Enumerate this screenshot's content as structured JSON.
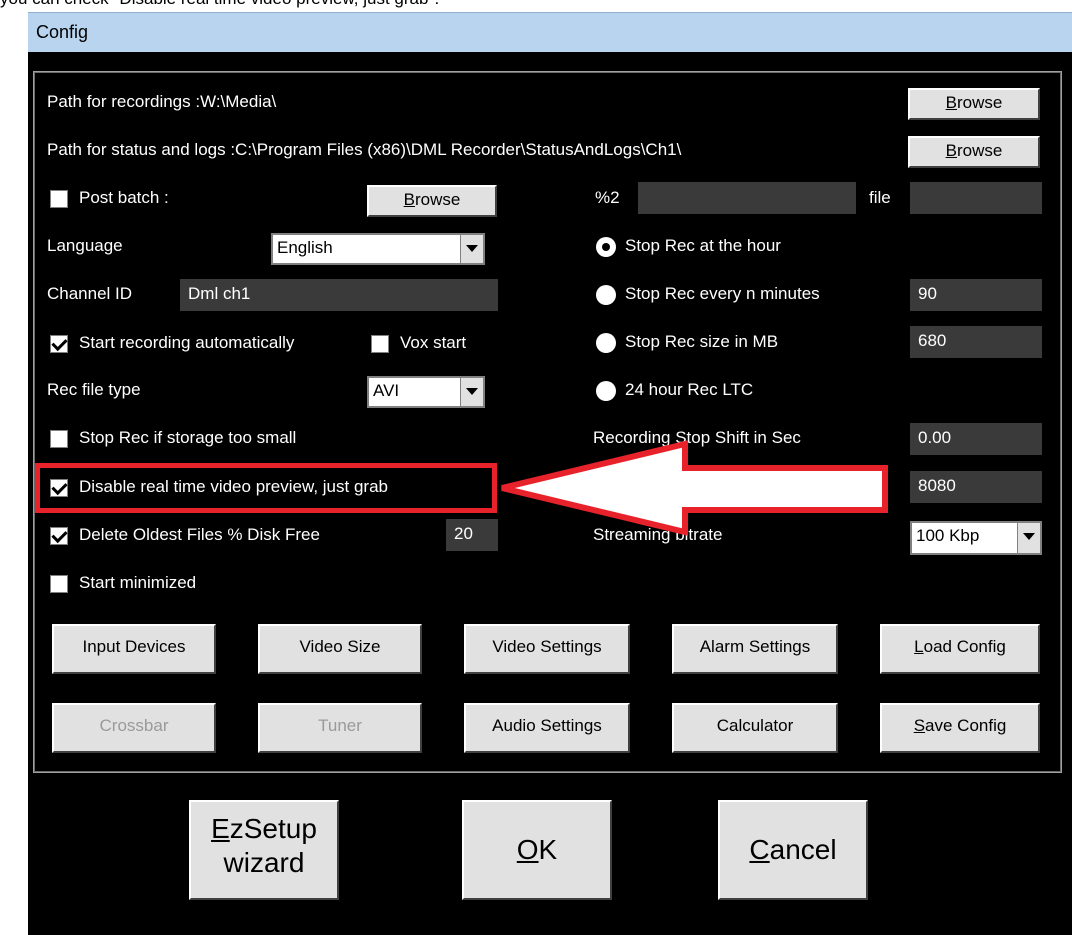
{
  "caption": "you can check \"Disable real time video preview, just grab\".",
  "window": {
    "title": "Config"
  },
  "paths": {
    "recordings": "Path for recordings :W:\\Media\\",
    "status_logs": "Path for status and logs :C:\\Program Files (x86)\\DML Recorder\\StatusAndLogs\\Ch1\\",
    "browse_hot": "B",
    "browse_rest": "rowse"
  },
  "left": {
    "post_batch": "Post batch :",
    "browse_hot": "B",
    "browse_rest": "rowse",
    "language_label": "Language",
    "language_value": "English",
    "channel_label": "Channel ID",
    "channel_value": "Dml ch1",
    "start_auto": "Start recording automatically",
    "vox_start": "Vox start",
    "rec_type_label": "Rec file type",
    "rec_type_value": "AVI",
    "stop_storage": "Stop Rec if storage too small",
    "disable_preview": "Disable real time video preview, just grab",
    "delete_oldest": "Delete Oldest Files % Disk Free",
    "delete_value": "20",
    "start_min": "Start minimized"
  },
  "right": {
    "pct2": "%2",
    "file": "file",
    "stop_hour": "Stop Rec at the hour",
    "stop_minutes": "Stop Rec every n minutes",
    "minutes_value": "90",
    "stop_size": "Stop Rec size in MB",
    "size_value": "680",
    "ltc": "24 hour Rec LTC",
    "shift_label": "Recording Stop Shift in Sec",
    "shift_value": "0.00",
    "port_value": "8080",
    "stream_label": "Streaming bitrate",
    "stream_value": "100 Kbp"
  },
  "buttons": {
    "input_devices": "Input Devices",
    "video_size": "Video Size",
    "video_settings": "Video Settings",
    "alarm_settings": "Alarm Settings",
    "load_hot": "L",
    "load_rest": "oad Config",
    "crossbar": "Crossbar",
    "tuner": "Tuner",
    "audio_settings": "Audio Settings",
    "calculator": "Calculator",
    "save_hot": "S",
    "save_rest": "ave Config"
  },
  "bottom": {
    "ez_hot": "E",
    "ez_rest": "zSetup",
    "ez_line2": "wizard",
    "ok_hot": "O",
    "ok_rest": "K",
    "cancel_hot": "C",
    "cancel_rest": "ancel"
  },
  "colors": {
    "highlight": "#e8222a",
    "window_bg": "#000000",
    "titlebar": "#b8d4ee"
  }
}
